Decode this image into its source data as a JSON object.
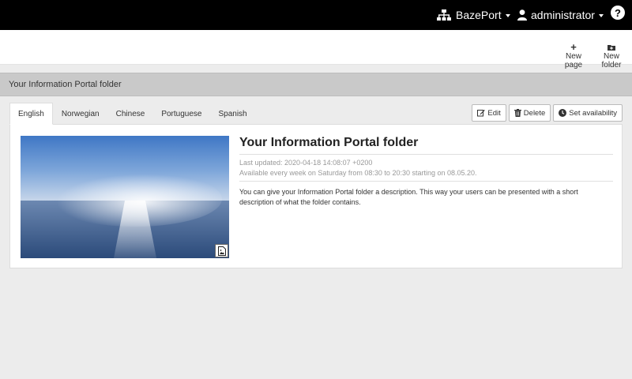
{
  "topbar": {
    "site": "BazePort",
    "user": "administrator",
    "help": "?"
  },
  "actions": {
    "new_page": "New page",
    "new_folder": "New folder"
  },
  "folder": {
    "bar_title": "Your Information Portal folder"
  },
  "tabs": [
    {
      "label": "English",
      "active": true
    },
    {
      "label": "Norwegian"
    },
    {
      "label": "Chinese"
    },
    {
      "label": "Portuguese"
    },
    {
      "label": "Spanish"
    }
  ],
  "buttons": {
    "edit": "Edit",
    "delete": "Delete",
    "availability": "Set availability"
  },
  "content": {
    "title": "Your Information Portal folder",
    "last_updated": "Last updated: 2020-04-18 14:08:07 +0200",
    "availability": "Available every week on Saturday from 08:30 to 20:30 starting on 08.05.20.",
    "description": "You can give your Information Portal folder a description. This way your users can be presented with a short description of what the folder contains."
  },
  "colors": {
    "topbar": "#000000",
    "folder_bar": "#c9c9c9",
    "background": "#ececec"
  }
}
